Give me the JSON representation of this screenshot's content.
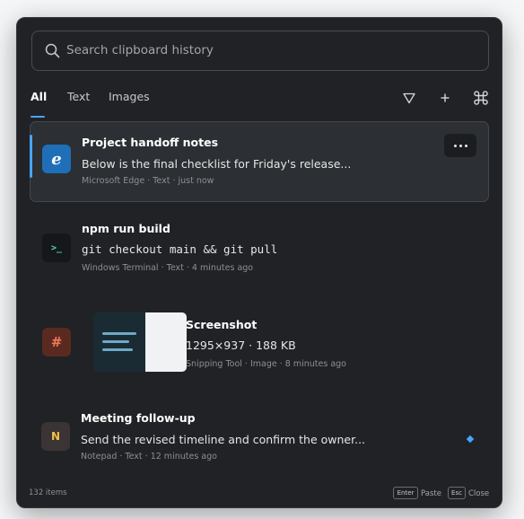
{
  "search": {
    "placeholder": "Search clipboard history"
  },
  "tabs": [
    {
      "label": "All",
      "active": true
    },
    {
      "label": "Text",
      "active": false
    },
    {
      "label": "Images",
      "active": false
    }
  ],
  "toolbar": {
    "filter_icon": "filter-icon",
    "add_icon": "plus-icon",
    "shortcut_icon": "command-key-icon"
  },
  "items": [
    {
      "title": "Project handoff notes",
      "preview": "Below is the final checklist for Friday's release...",
      "meta": "Microsoft Edge · Text · just now",
      "app_icon": "edge-icon",
      "app_icon_label": "e",
      "selected": true
    },
    {
      "title": "npm run build",
      "preview": "git checkout main && git pull",
      "meta": "Windows Terminal · Text · 4 minutes ago",
      "app_icon": "terminal-icon",
      "app_icon_label": ">_"
    },
    {
      "title": "Screenshot",
      "preview": "1295×937 · 188 KB",
      "meta": "Snipping Tool · Image · 8 minutes ago",
      "app_icon": "snipping-tool-icon",
      "app_icon_label": "#"
    },
    {
      "title": "Meeting follow-up",
      "preview": "Send the revised timeline and confirm the owner...",
      "meta": "Notepad · Text · 12 minutes ago",
      "app_icon": "notepad-icon",
      "app_icon_label": "N",
      "pinned": true
    }
  ],
  "footer": {
    "count": "132 items",
    "enter_key": "Enter",
    "enter_label": "Paste",
    "esc_key": "Esc",
    "esc_label": "Close"
  },
  "colors": {
    "accent": "#4aa3ff",
    "panel_bg": "#202225",
    "selected_bg": "#2c2f33"
  }
}
